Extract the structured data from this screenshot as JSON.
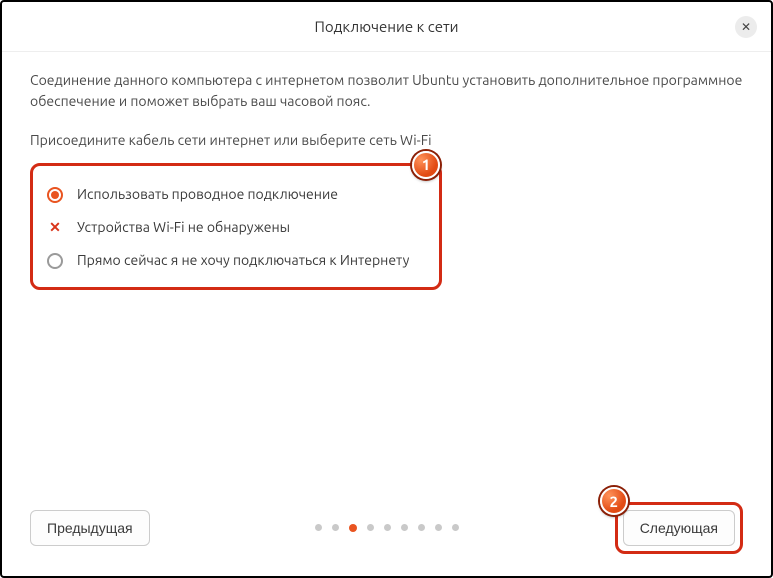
{
  "header": {
    "title": "Подключение к сети"
  },
  "intro": "Соединение данного компьютера с интернетом позволит Ubuntu установить дополнительное программное обеспечение и поможет выбрать ваш часовой пояс.",
  "prompt": "Присоедините кабель сети интернет или выберите сеть Wi-Fi",
  "options": {
    "wired": {
      "label": "Использовать проводное подключение",
      "selected": true
    },
    "wifi": {
      "label": "Устройства Wi-Fi не обнаружены"
    },
    "nolink": {
      "label": "Прямо сейчас я не хочу подключаться к Интернету"
    }
  },
  "callouts": {
    "one": "1",
    "two": "2"
  },
  "footer": {
    "prev": "Предыдущая",
    "next": "Следующая"
  },
  "progress": {
    "total": 9,
    "active_index": 2
  }
}
